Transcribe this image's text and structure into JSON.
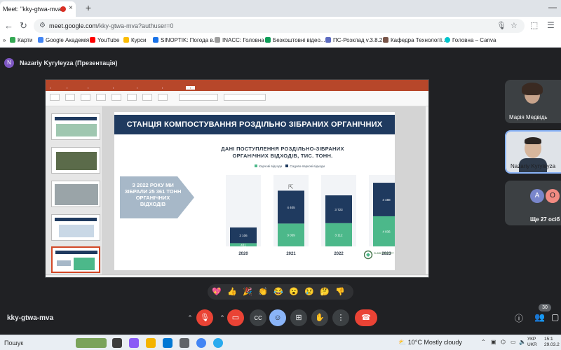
{
  "browser": {
    "tab_title": "Meet: \"kky-gtwa-mva\"",
    "new_tab": "+",
    "window_controls": "—",
    "url_host": "meet.google.com",
    "url_path": "/kky-gtwa-mva?authuser=0",
    "bookmarks": [
      {
        "label": "Карти",
        "color": "#34a853"
      },
      {
        "label": "Google Академія",
        "color": "#4285f4"
      },
      {
        "label": "YouTube",
        "color": "#ff0000"
      },
      {
        "label": "Курси",
        "color": "#fbbc05"
      },
      {
        "label": "SINOPTIK: Погода в...",
        "color": "#1a73e8"
      },
      {
        "label": "INACC: Головна",
        "color": "#9e9e9e"
      },
      {
        "label": "Безкоштовні відео...",
        "color": "#0f9d58"
      },
      {
        "label": "ПС-Розклад v.3.8.2",
        "color": "#5c6bc0"
      },
      {
        "label": "Кафедра Технології...",
        "color": "#795548"
      },
      {
        "label": "Головна – Canva",
        "color": "#00c4cc"
      }
    ]
  },
  "meet": {
    "presenter_initial": "N",
    "presenter_label": "Nazariy Kyryleyza (Презентація)",
    "meeting_code": "kky-gtwa-mva",
    "participants": [
      {
        "name": "Марія Медвідь"
      },
      {
        "name": "Nazariy Kyrylеyza"
      }
    ],
    "others_label": "Ще 27 осіб",
    "others_avatars": [
      "A",
      "O"
    ],
    "people_count": "30",
    "reactions": [
      "💖",
      "👍",
      "🎉",
      "👏",
      "😂",
      "😮",
      "😢",
      "🤔",
      "👎"
    ]
  },
  "slide": {
    "title": "СТАНЦІЯ КОМПОСТУВАННЯ РОЗДІЛЬНО ЗІБРАНИХ ОРГАНІЧНИХ ВІДХОДІВ",
    "callout": "З 2022 РОКУ МИ ЗІБРАЛИ 25 361 ТОНН ОРГАНІЧНИХ ВІДХОДІВ",
    "logo_text": "ЛЬВІВ КОМПОСТ",
    "colors": {
      "dark": "#1f3a5f",
      "green": "#4cb88a",
      "arrow": "#a7b8c8"
    }
  },
  "chart_data": {
    "type": "bar",
    "title": "ДАНІ ПОСТУПЛЕННЯ РОЗДІЛЬНО-ЗІБРАНИХ ОРГАНІЧНИХ ВІДХОДІВ, ТИС. ТОНН.",
    "categories": [
      "2020",
      "2021",
      "2022",
      "2023"
    ],
    "series": [
      {
        "name": "Харчові відходи",
        "values": [
          431,
          3059,
          3112,
          4036
        ]
      },
      {
        "name": "Садово-паркові відходи",
        "values": [
          2106,
          4405,
          3723,
          4488
        ]
      }
    ],
    "stacked": true,
    "legend": "top",
    "grid": false
  },
  "taskbar": {
    "search": "Пошук",
    "weather_temp": "10°C",
    "weather_text": "Mostly cloudy",
    "lang_line1": "УКР",
    "lang_line2": "UKR",
    "time": "15:1",
    "date": "29.03.2"
  }
}
